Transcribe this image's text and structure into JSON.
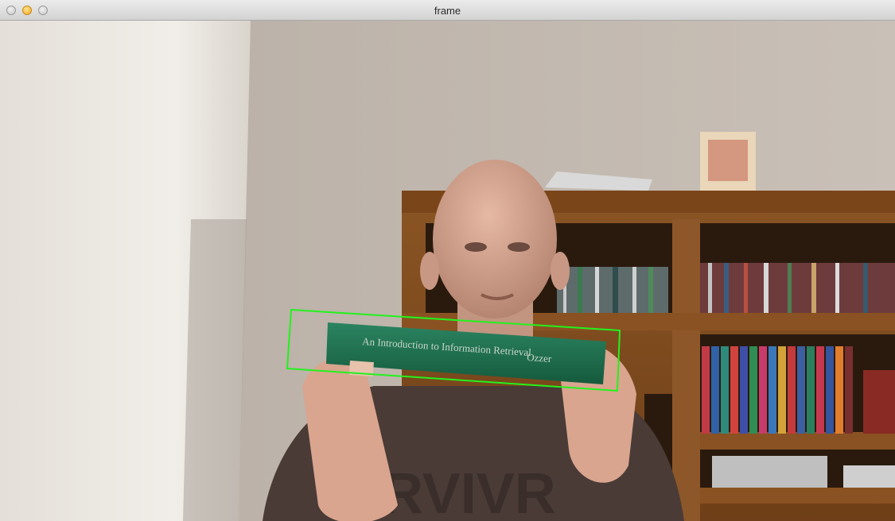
{
  "window": {
    "title": "frame"
  },
  "titlebar_buttons": [
    "close",
    "minimize",
    "zoom"
  ],
  "colors": {
    "detection_box": "#22f21c",
    "book": "#1f6b4d"
  },
  "video": {
    "book_spine_text": "An Introduction to Information Retrieval",
    "book_author_text": "Ozzer",
    "shirt_text": "RVIVR"
  }
}
